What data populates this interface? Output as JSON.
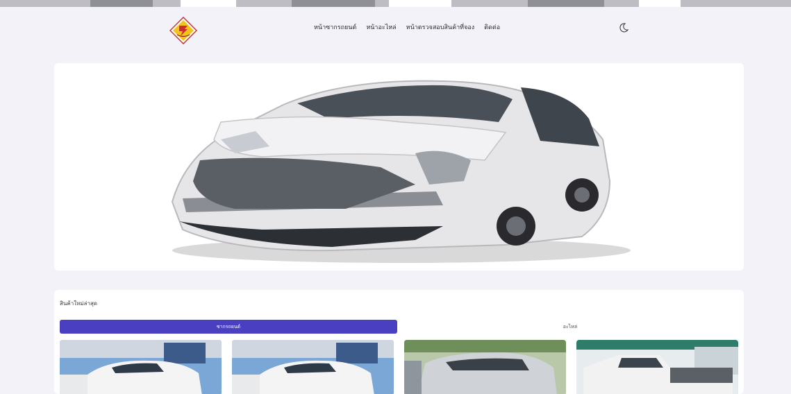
{
  "nav": {
    "items": [
      {
        "label": "หน้าซากรถยนต์"
      },
      {
        "label": "หน้าอะไหล่"
      },
      {
        "label": "หน้าตรวจสอบสินค้าที่จอง"
      },
      {
        "label": "ติดต่อ"
      }
    ]
  },
  "icons": {
    "logo": "brand-logo-diamond",
    "theme_toggle": "moon-icon"
  },
  "latest": {
    "title": "สินค้าใหม่ล่าสุด",
    "tabs": [
      {
        "label": "ซากรถยนต์",
        "active": true
      },
      {
        "label": "อะไหล่",
        "active": false
      }
    ]
  },
  "colors": {
    "accent": "#4a3fc0",
    "background": "#f3f2f9",
    "logo_yellow": "#f2c318",
    "logo_red": "#c9302c"
  }
}
